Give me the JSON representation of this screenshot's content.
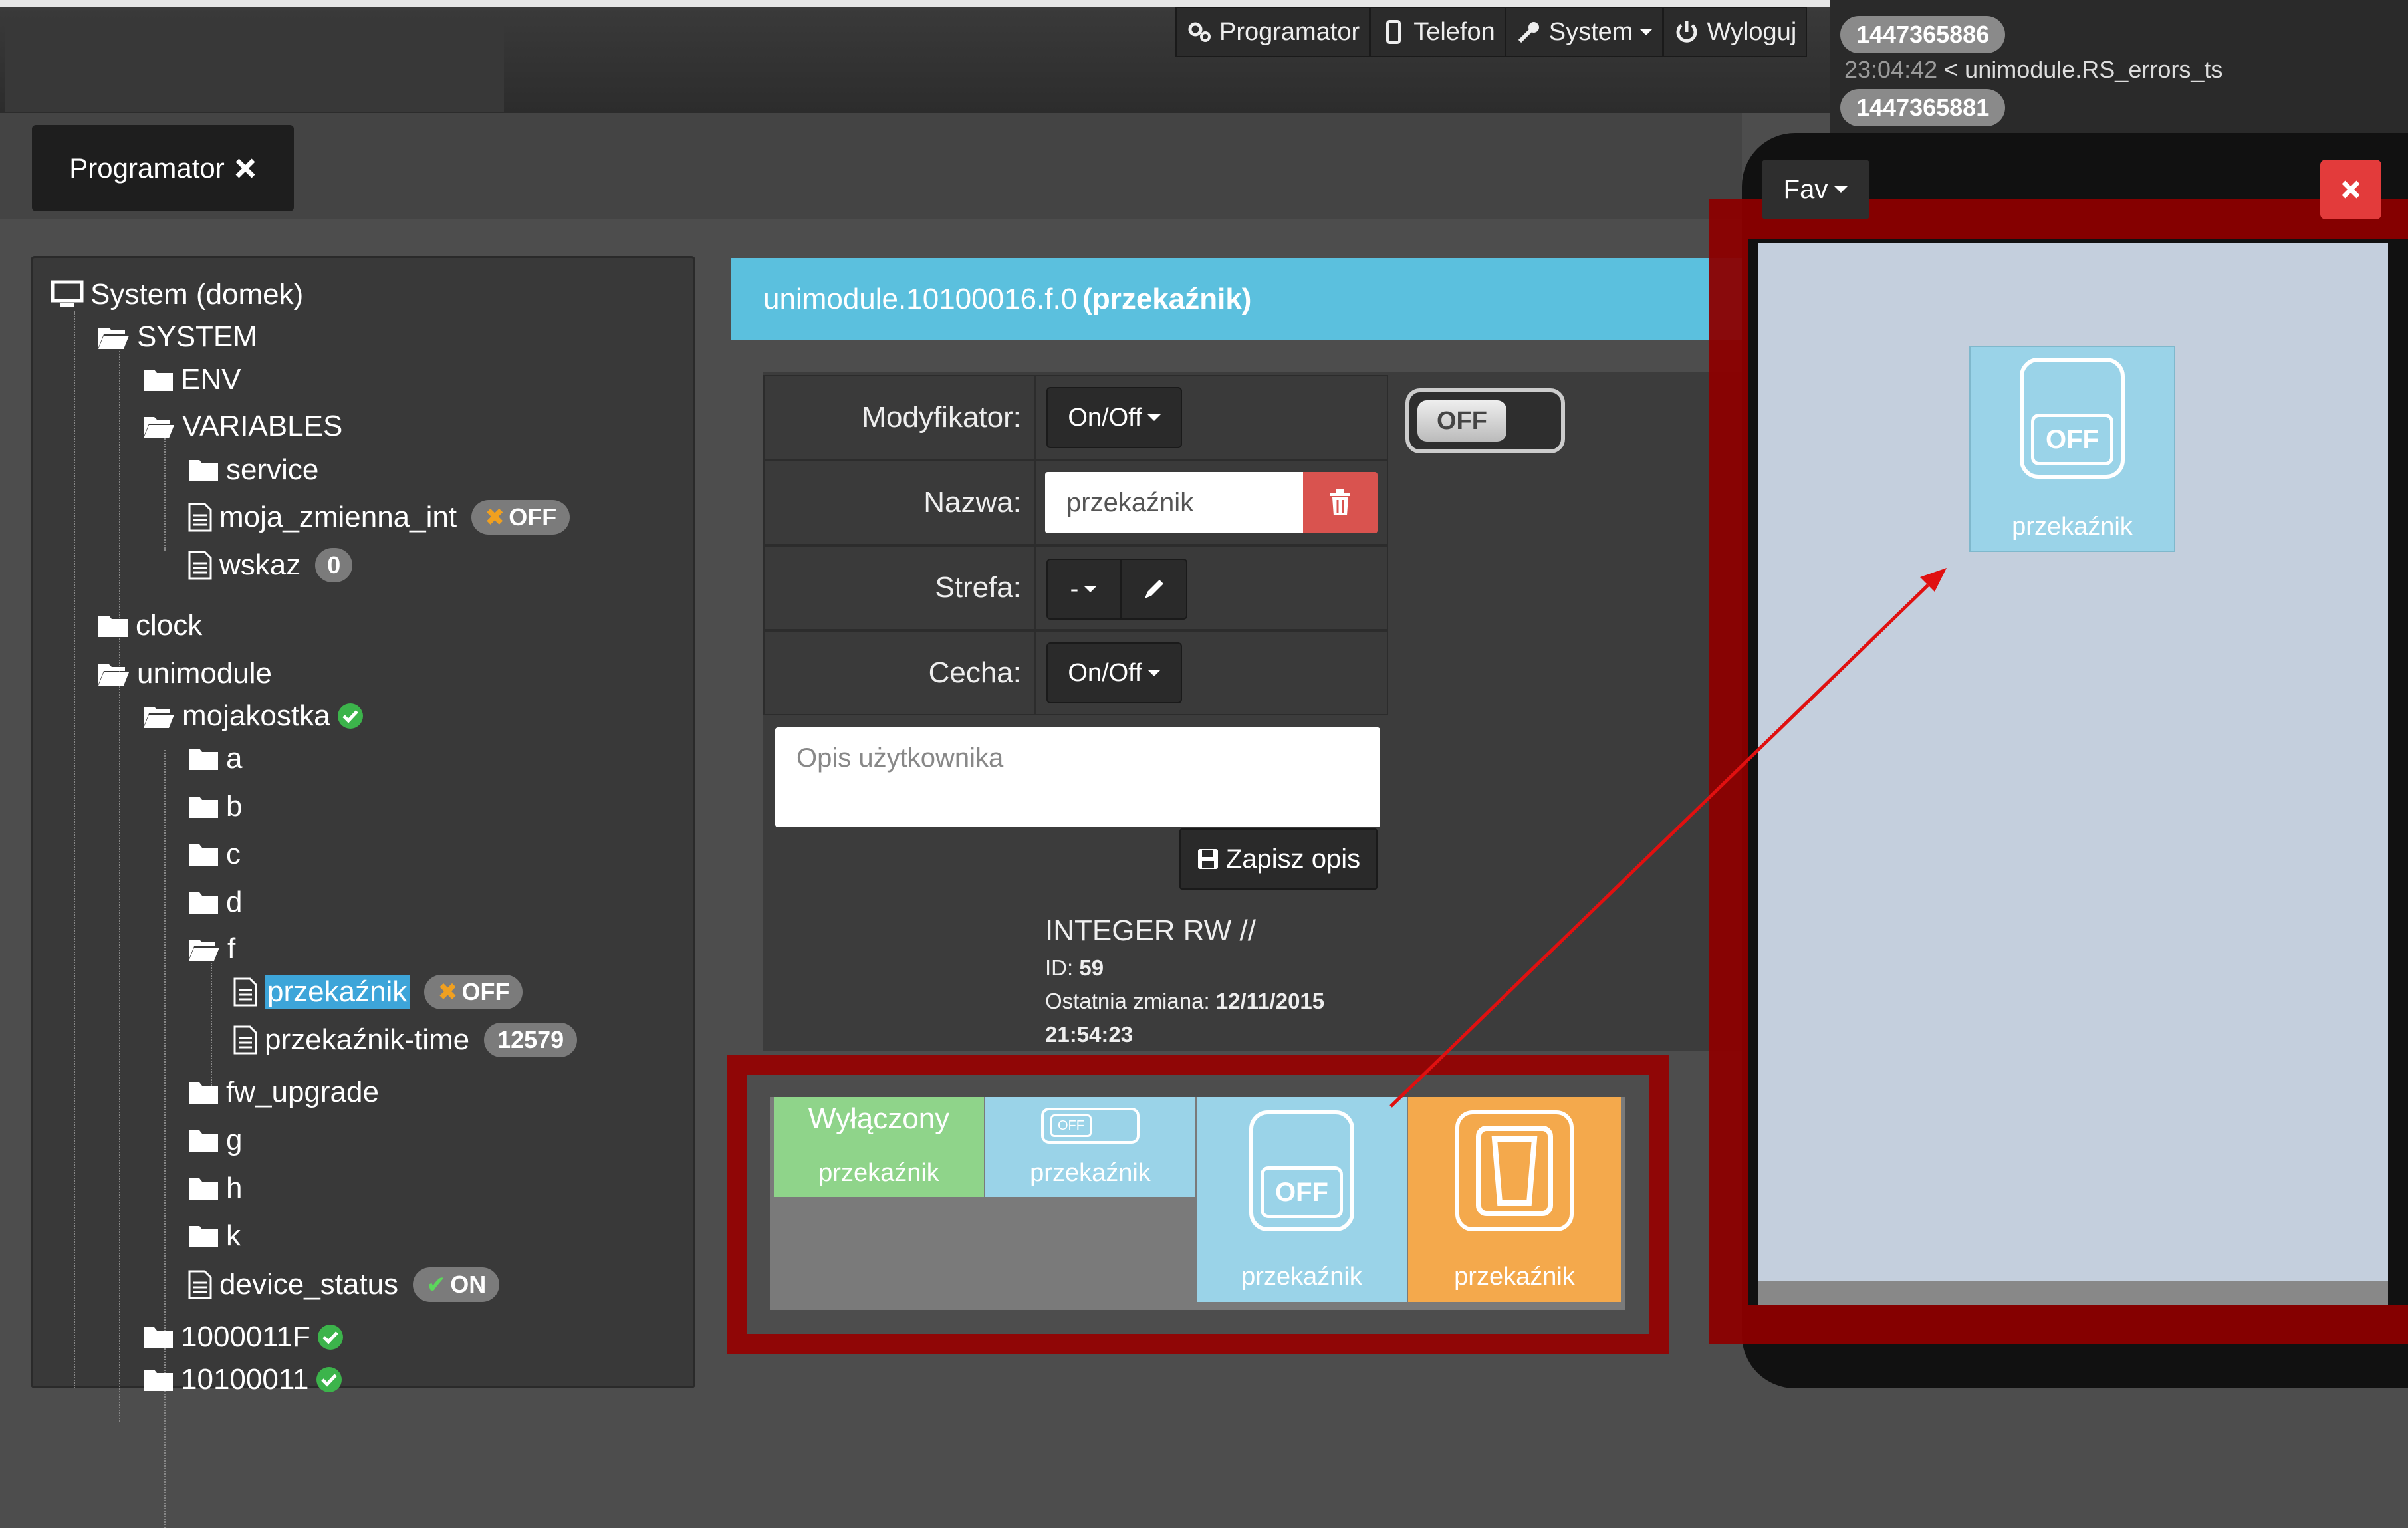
{
  "topnav": {
    "items": [
      {
        "label": "Programator",
        "icon": "gears-icon"
      },
      {
        "label": "Telefon",
        "icon": "phone-icon"
      },
      {
        "label": "System",
        "icon": "wrench-icon"
      },
      {
        "label": "Wyloguj",
        "icon": "power-icon"
      }
    ]
  },
  "notifications": {
    "badge1": "1447365886",
    "line1_time": "23:04:42",
    "line1_text": " < unimodule.RS_errors_ts",
    "badge2": "1447365881"
  },
  "tab": {
    "label": "Programator"
  },
  "tree": {
    "system_root": "System (domek)",
    "SYSTEM": "SYSTEM",
    "ENV": "ENV",
    "VARIABLES": "VARIABLES",
    "service": "service",
    "moja_zmienna_int": "moja_zmienna_int",
    "moja_zmienna_int_value": "OFF",
    "wskaz": "wskaz",
    "wskaz_value": "0",
    "clock": "clock",
    "unimodule": "unimodule",
    "mojakostka": "mojakostka",
    "a": "a",
    "b": "b",
    "c": "c",
    "d": "d",
    "f": "f",
    "przekaznik": "przekaźnik",
    "przekaznik_value": "OFF",
    "przekaznik_time": "przekaźnik-time",
    "przekaznik_time_value": "12579",
    "fw_upgrade": "fw_upgrade",
    "g": "g",
    "h": "h",
    "k": "k",
    "device_status": "device_status",
    "device_status_value": "ON",
    "n1000011F": "1000011F",
    "n10100011": "10100011"
  },
  "detail": {
    "header_prefix": "unimodule.10100016.f.0 ",
    "header_name": "(przekaźnik)",
    "modyfikator_label": "Modyfikator:",
    "modyfikator_value": "On/Off",
    "toggle_state": "OFF",
    "nazwa_label": "Nazwa:",
    "nazwa_value": "przekaźnik",
    "strefa_label": "Strefa:",
    "strefa_value": "-",
    "cecha_label": "Cecha:",
    "cecha_value": "On/Off",
    "opis_placeholder": "Opis użytkownika",
    "save_label": "Zapisz opis",
    "type_line": "INTEGER RW //",
    "id_label": "ID: ",
    "id_value": "59",
    "change_label": "Ostatnia zmiana: ",
    "change_date": "12/11/2015",
    "change_time": "21:54:23"
  },
  "tiles": [
    {
      "title": "Wyłączony",
      "label": "przekaźnik",
      "color": "#8fd48a"
    },
    {
      "title": "OFF",
      "label": "przekaźnik",
      "color": "#9ad3e8"
    },
    {
      "title": "OFF",
      "label": "przekaźnik",
      "color": "#9ad3e8"
    },
    {
      "title": "",
      "label": "przekaźnik",
      "color": "#f4a94c"
    }
  ],
  "fav": {
    "button_label": "Fav",
    "tile_state": "OFF",
    "tile_label": "przekaźnik"
  },
  "colors": {
    "accent": "#5bc0de",
    "danger": "#d9534f",
    "highlight": "#960000"
  }
}
